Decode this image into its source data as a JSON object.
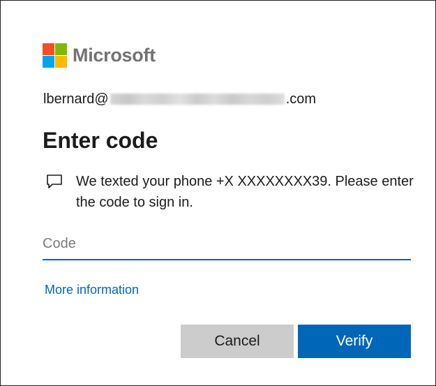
{
  "brand": {
    "name": "Microsoft",
    "logo_colors": [
      "#f25022",
      "#7fba00",
      "#00a4ef",
      "#ffb900"
    ]
  },
  "identity": {
    "prefix": "lbernard@",
    "suffix": ".com"
  },
  "page": {
    "title": "Enter code"
  },
  "message": {
    "icon": "chat-bubble-icon",
    "text": "We texted your phone +X XXXXXXXX39. Please enter the code to sign in."
  },
  "code_field": {
    "placeholder": "Code",
    "value": ""
  },
  "links": {
    "more_information": "More information"
  },
  "buttons": {
    "cancel": "Cancel",
    "verify": "Verify"
  },
  "colors": {
    "accent": "#0067b8",
    "secondary_button": "#cccccc"
  }
}
